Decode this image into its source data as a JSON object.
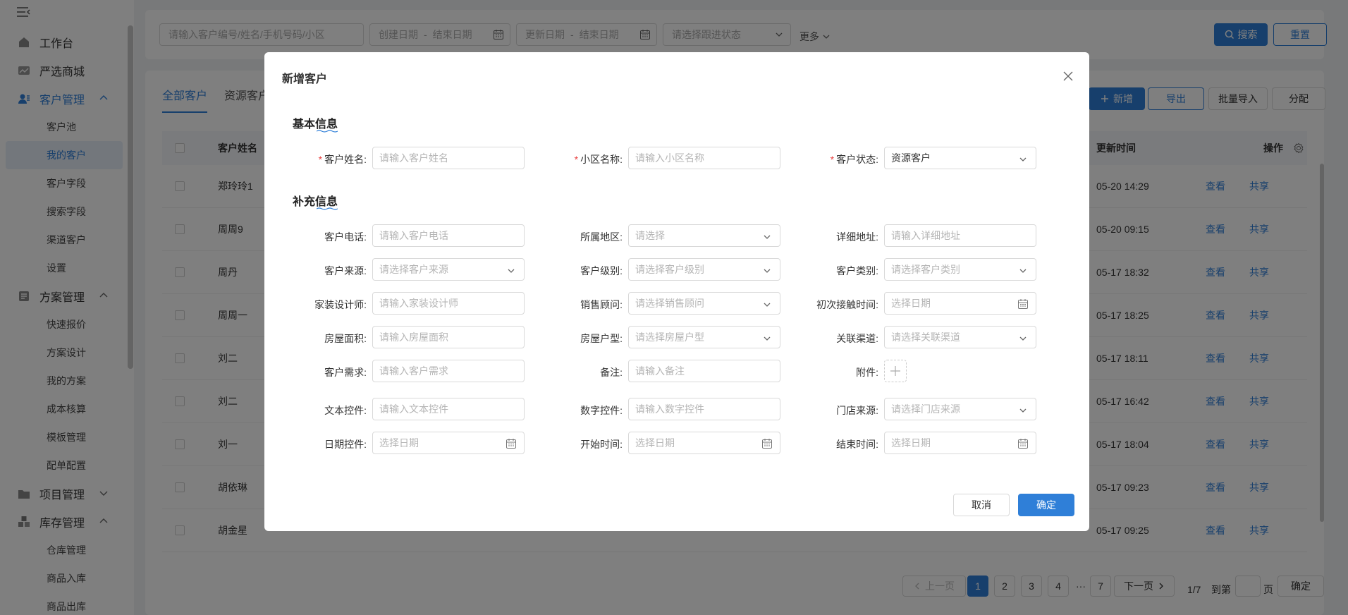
{
  "sidebar": {
    "items": [
      {
        "label": "工作台",
        "icon": "home-icon"
      },
      {
        "label": "严选商城",
        "icon": "mall-icon"
      },
      {
        "label": "客户管理",
        "icon": "customer-icon",
        "expanded": true,
        "children": [
          "客户池",
          "我的客户",
          "客户字段",
          "搜索字段",
          "渠道客户",
          "设置"
        ],
        "active_child": 1
      },
      {
        "label": "方案管理",
        "icon": "plan-icon",
        "expanded": true,
        "children": [
          "快速报价",
          "方案设计",
          "我的方案",
          "成本核算",
          "模板管理",
          "配单配置"
        ]
      },
      {
        "label": "项目管理",
        "icon": "project-icon",
        "expanded": false
      },
      {
        "label": "库存管理",
        "icon": "inventory-icon",
        "expanded": true,
        "children": [
          "仓库管理",
          "商品入库",
          "商品出库"
        ]
      }
    ]
  },
  "search": {
    "keyword_placeholder": "请输入客户编号/姓名/手机号码/小区",
    "created_start": "创建日期",
    "created_end": "结束日期",
    "updated_start": "更新日期",
    "updated_end": "结束日期",
    "status_placeholder": "请选择跟进状态",
    "more": "更多",
    "search_label": "搜索",
    "reset_label": "重置"
  },
  "main": {
    "tabs": [
      "全部客户",
      "资源客户"
    ],
    "actions": {
      "add": "新增",
      "export": "导出",
      "import": "批量导入",
      "assign": "分配"
    },
    "columns": {
      "name": "客户姓名",
      "updated": "更新时间",
      "ops": "操作"
    },
    "rows": [
      {
        "name": "郑玲玲1",
        "updated": "05-20 14:29"
      },
      {
        "name": "周周9",
        "updated": "05-20 09:15"
      },
      {
        "name": "周丹",
        "updated": "05-17 18:32"
      },
      {
        "name": "周周一",
        "updated": "05-17 18:25"
      },
      {
        "name": "刘二",
        "updated": "05-17 18:11"
      },
      {
        "name": "刘二",
        "updated": "05-17 16:42"
      },
      {
        "name": "刘一",
        "updated": "05-17 18:04"
      },
      {
        "name": "胡依琳",
        "updated": "05-17 09:23"
      },
      {
        "name": "胡金星",
        "updated": "05-17 09:25"
      }
    ],
    "row_view": "查看",
    "row_share": "共享"
  },
  "pagination": {
    "prev": "上一页",
    "pages": [
      "1",
      "2",
      "3",
      "4",
      "···",
      "7"
    ],
    "current": "1",
    "next": "下一页",
    "total": "1/7",
    "goto_prefix": "到第",
    "goto_suffix": "页",
    "confirm": "确定"
  },
  "modal": {
    "title": "新增客户",
    "basic_title": "基本信息",
    "extra_title": "补充信息",
    "basic_fields": [
      {
        "label": "客户姓名",
        "required": true,
        "placeholder": "请输入客户姓名",
        "type": "text"
      },
      {
        "label": "小区名称",
        "required": true,
        "placeholder": "请输入小区名称",
        "type": "text"
      },
      {
        "label": "客户状态",
        "required": true,
        "value": "资源客户",
        "type": "select"
      }
    ],
    "extra_fields": [
      {
        "label": "客户电话",
        "placeholder": "请输入客户电话",
        "type": "text"
      },
      {
        "label": "所属地区",
        "placeholder": "请选择",
        "type": "select"
      },
      {
        "label": "详细地址",
        "placeholder": "请输入详细地址",
        "type": "text"
      },
      {
        "label": "客户来源",
        "placeholder": "请选择客户来源",
        "type": "select"
      },
      {
        "label": "客户级别",
        "placeholder": "请选择客户级别",
        "type": "select"
      },
      {
        "label": "客户类别",
        "placeholder": "请选择客户类别",
        "type": "select"
      },
      {
        "label": "家装设计师",
        "placeholder": "请输入家装设计师",
        "type": "text"
      },
      {
        "label": "销售顾问",
        "placeholder": "请选择销售顾问",
        "type": "select"
      },
      {
        "label": "初次接触时间",
        "placeholder": "选择日期",
        "type": "date"
      },
      {
        "label": "房屋面积",
        "placeholder": "请输入房屋面积",
        "type": "text"
      },
      {
        "label": "房屋户型",
        "placeholder": "请选择房屋户型",
        "type": "select"
      },
      {
        "label": "关联渠道",
        "placeholder": "请选择关联渠道",
        "type": "select"
      },
      {
        "label": "客户需求",
        "placeholder": "请输入客户需求",
        "type": "text"
      },
      {
        "label": "备注",
        "placeholder": "请输入备注",
        "type": "text"
      },
      {
        "label": "附件",
        "placeholder": "",
        "type": "upload"
      },
      {
        "label": "文本控件",
        "placeholder": "请输入文本控件",
        "type": "text"
      },
      {
        "label": "数字控件",
        "placeholder": "请输入数字控件",
        "type": "text"
      },
      {
        "label": "门店来源",
        "placeholder": "请选择门店来源",
        "type": "select"
      },
      {
        "label": "日期控件",
        "placeholder": "选择日期",
        "type": "date"
      },
      {
        "label": "开始时间",
        "placeholder": "选择日期",
        "type": "date"
      },
      {
        "label": "结束时间",
        "placeholder": "选择日期",
        "type": "date"
      }
    ],
    "cancel": "取消",
    "ok": "确定"
  },
  "colors": {
    "primary": "#2f7fd8",
    "required": "#e84040",
    "overlay": "rgba(0,0,0,0.5)"
  }
}
